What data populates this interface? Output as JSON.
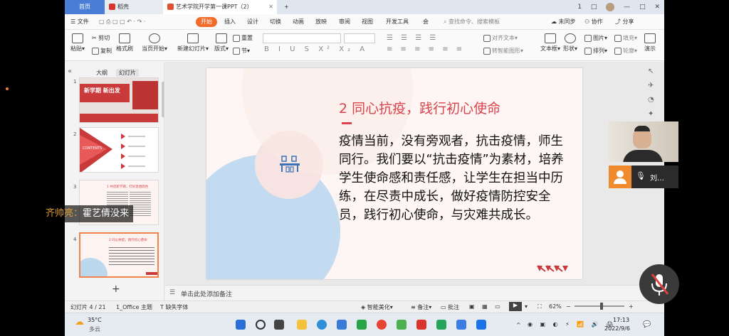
{
  "titlebar": {
    "tabs": [
      {
        "label": "首页"
      },
      {
        "label": "稻壳"
      },
      {
        "label": "艺术学院开学第一课PPT（2）"
      }
    ],
    "window_controls": [
      "1",
      "□",
      "—",
      "□",
      "✕"
    ]
  },
  "menubar": {
    "file": "文件",
    "items": [
      "开始",
      "插入",
      "设计",
      "切换",
      "动画",
      "放映",
      "审阅",
      "视图",
      "开发工具",
      "会"
    ],
    "active": "开始",
    "search_placeholder": "查找命令、搜索模板",
    "right": [
      "未同步",
      "协作",
      "分享"
    ]
  },
  "ribbon": {
    "paste": "粘贴",
    "cut": "剪切",
    "copy": "复制",
    "format_painter": "格式刷",
    "start_from": "当页开始",
    "new_slide": "新建幻灯片",
    "layout": "版式",
    "section": "节",
    "reset": "重置",
    "align_text": "对齐文本",
    "smartart": "转智能图形",
    "textbox": "文本框",
    "shape": "形状",
    "arrange": "排列",
    "picture": "图片",
    "fill": "填充",
    "outline": "轮廓",
    "present": "演示"
  },
  "left_pane": {
    "tab_outline": "大纲",
    "tab_slides": "幻灯片",
    "thumbs": [
      {
        "num": "1",
        "title": "新学期 新出发"
      },
      {
        "num": "2",
        "title": "CONTENTS"
      },
      {
        "num": "3",
        "title": "1 共话新学期，打好思想底色"
      },
      {
        "num": "4",
        "title": "2 同心抗疫，践行初心使命"
      }
    ],
    "add": "+"
  },
  "slide": {
    "title": "2 同心抗疫，践行初心使命",
    "body": "疫情当前，没有旁观者，抗击疫情，师生同行。我们要以“抗击疫情”为素材，培养学生使命感和责任感，让学生在担当中历练，在尽责中成长，做好疫情防控安全员，践行初心使命，与灾难共成长。"
  },
  "notes_placeholder": "单击此处添加备注",
  "statusbar": {
    "slide_count": "幻灯片 4 / 21",
    "theme": "1_Office 主题",
    "missing_font": "缺失字体",
    "beautify": "智能美化",
    "notes": "备注",
    "comments": "批注",
    "zoom": "62%"
  },
  "taskbar": {
    "weather_temp": "35°C",
    "weather_desc": "多云",
    "time": "17:13",
    "date": "2022/9/6"
  },
  "meeting": {
    "participant": "刘…",
    "subtitle_speaker": "齐帅亮：",
    "subtitle_text": "霍艺倩没来"
  },
  "colors": {
    "accent": "#f26b2b",
    "slide_title": "#d9434b",
    "home_tab": "#4a7ed6"
  }
}
